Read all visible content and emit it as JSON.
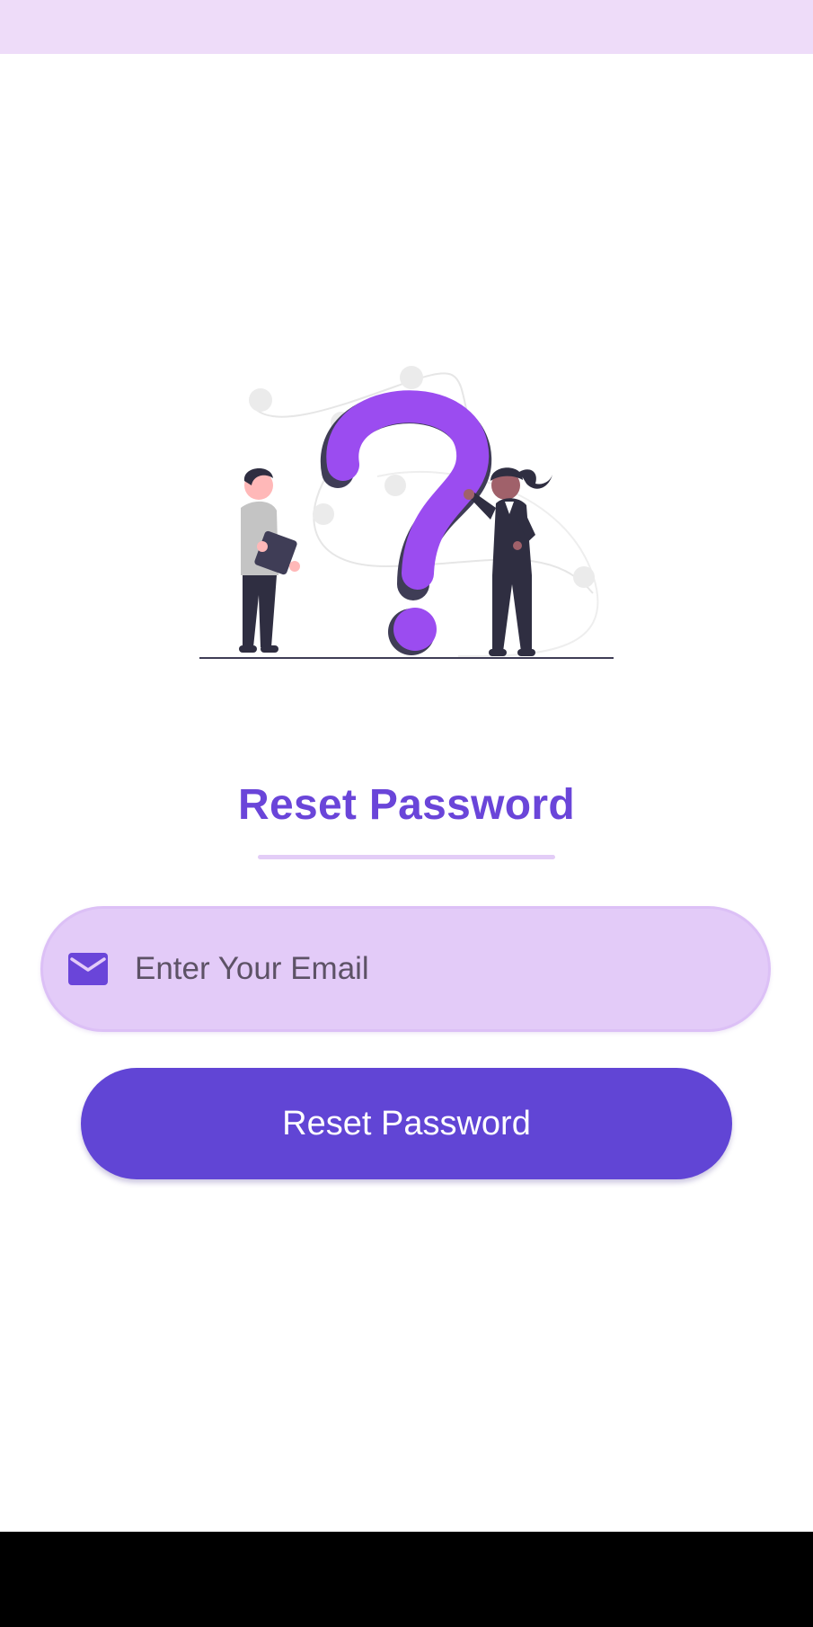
{
  "status_bar": {
    "color": "#eedcf9"
  },
  "illustration": {
    "icon": "question-mark-people-illustration",
    "accent": "#9b4cf0"
  },
  "header": {
    "title": "Reset Password"
  },
  "form": {
    "email": {
      "icon": "mail-icon",
      "placeholder": "Enter Your Email",
      "value": ""
    },
    "submit_label": "Reset Password"
  },
  "colors": {
    "primary": "#6145d5",
    "title": "#6a45d9",
    "input_bg": "#e3cbf8"
  }
}
